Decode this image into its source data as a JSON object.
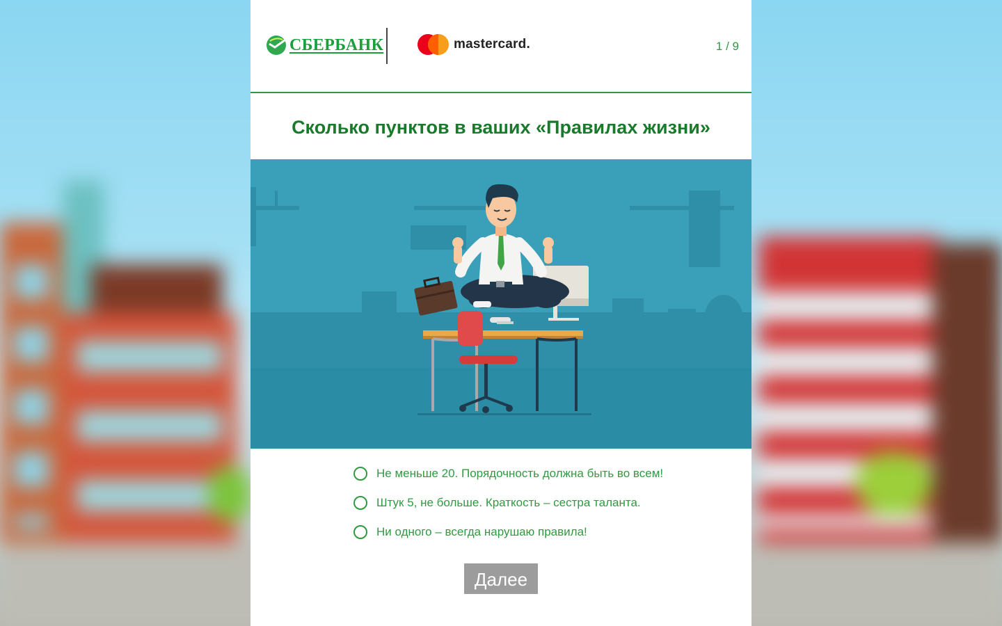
{
  "header": {
    "sber_logo_text": "СБЕРБАНК",
    "mastercard_logo_text": "mastercard.",
    "page_counter": "1 / 9"
  },
  "question": {
    "title": "Сколько пунктов в ваших «Правилах жизни»"
  },
  "answers": [
    {
      "label": "Не меньше 20. Порядочность должна быть во всем!",
      "selected": false
    },
    {
      "label": "Штук 5, не больше. Краткость – сестра таланта.",
      "selected": false
    },
    {
      "label": "Ни одного – всегда нарушаю правила!",
      "selected": false
    }
  ],
  "next_button": {
    "label": "Далее"
  },
  "colors": {
    "brand_green": "#2f9a41",
    "title_green": "#197a2c",
    "illustration_bg": "#3ba1ba",
    "button_gray": "#9c9c9c"
  },
  "icons": [
    "sberbank-logo-icon",
    "mastercard-logo-icon",
    "radio-icon"
  ]
}
